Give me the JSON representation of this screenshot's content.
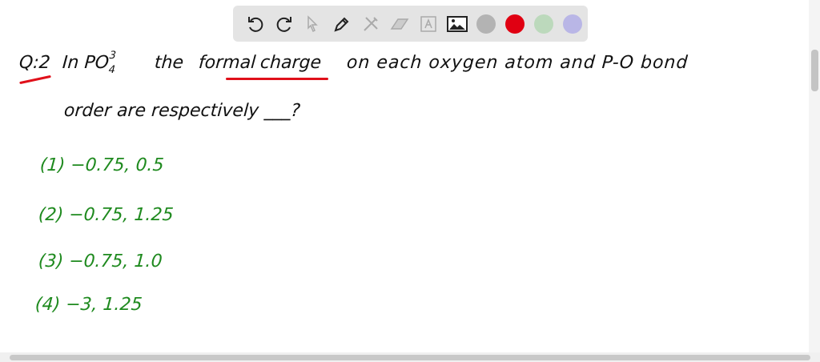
{
  "toolbar": {
    "tools": [
      "undo-icon",
      "redo-icon",
      "select-icon",
      "pen-icon",
      "tools-icon",
      "eraser-icon",
      "text-icon",
      "image-icon"
    ],
    "colors": [
      "#b3b3b3",
      "#e00012",
      "#bcd9bc",
      "#b9b6e6"
    ]
  },
  "question": {
    "number": "Q:2",
    "line1_a": "In PO",
    "charge": "3",
    "sub": "4",
    "line1_b": "the",
    "formal": "formal",
    "charge_word": "charge",
    "line1_c": "on each oxygen atom and P-O bond",
    "line2": "order are respectively ___?"
  },
  "options": [
    {
      "num": "1",
      "text": "−0.75, 0.5"
    },
    {
      "num": "2",
      "text": "−0.75, 1.25"
    },
    {
      "num": "3",
      "text": "−0.75, 1.0"
    },
    {
      "num": "4",
      "text": "−3, 1.25"
    }
  ]
}
